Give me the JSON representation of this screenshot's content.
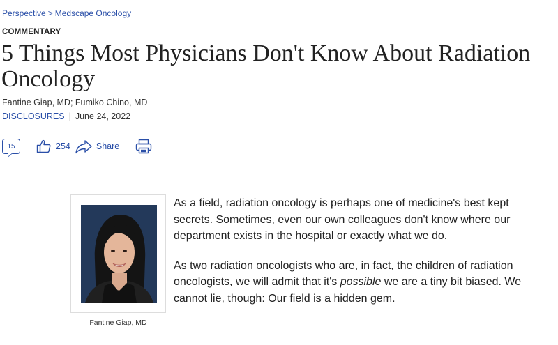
{
  "breadcrumb": {
    "items": [
      "Perspective",
      "Medscape Oncology"
    ],
    "separator": ">"
  },
  "article": {
    "label": "COMMENTARY",
    "title": "5 Things Most Physicians Don't Know About Radiation Oncology",
    "authors": "Fantine Giap, MD; Fumiko Chino, MD",
    "disclosures": "DISCLOSURES",
    "date": "June 24, 2022"
  },
  "actions": {
    "comments": "15",
    "likes": "254",
    "share": "Share"
  },
  "figure": {
    "caption": "Fantine Giap, MD"
  },
  "body": {
    "p1": "As a field, radiation oncology is perhaps one of medicine's best kept secrets. Sometimes, even our own colleagues don't know where our department exists in the hospital or exactly what we do.",
    "p2_before": "As two radiation oncologists who are, in fact, the children of radiation oncologists, we will admit that it's ",
    "p2_em": "possible",
    "p2_after": " we are a tiny bit biased. We cannot lie, though: Our field is a hidden gem."
  },
  "colors": {
    "link": "#2a4fa8",
    "text": "#222222"
  },
  "icons": [
    "comment-icon",
    "thumbs-up-icon",
    "share-arrow-icon",
    "print-icon"
  ]
}
